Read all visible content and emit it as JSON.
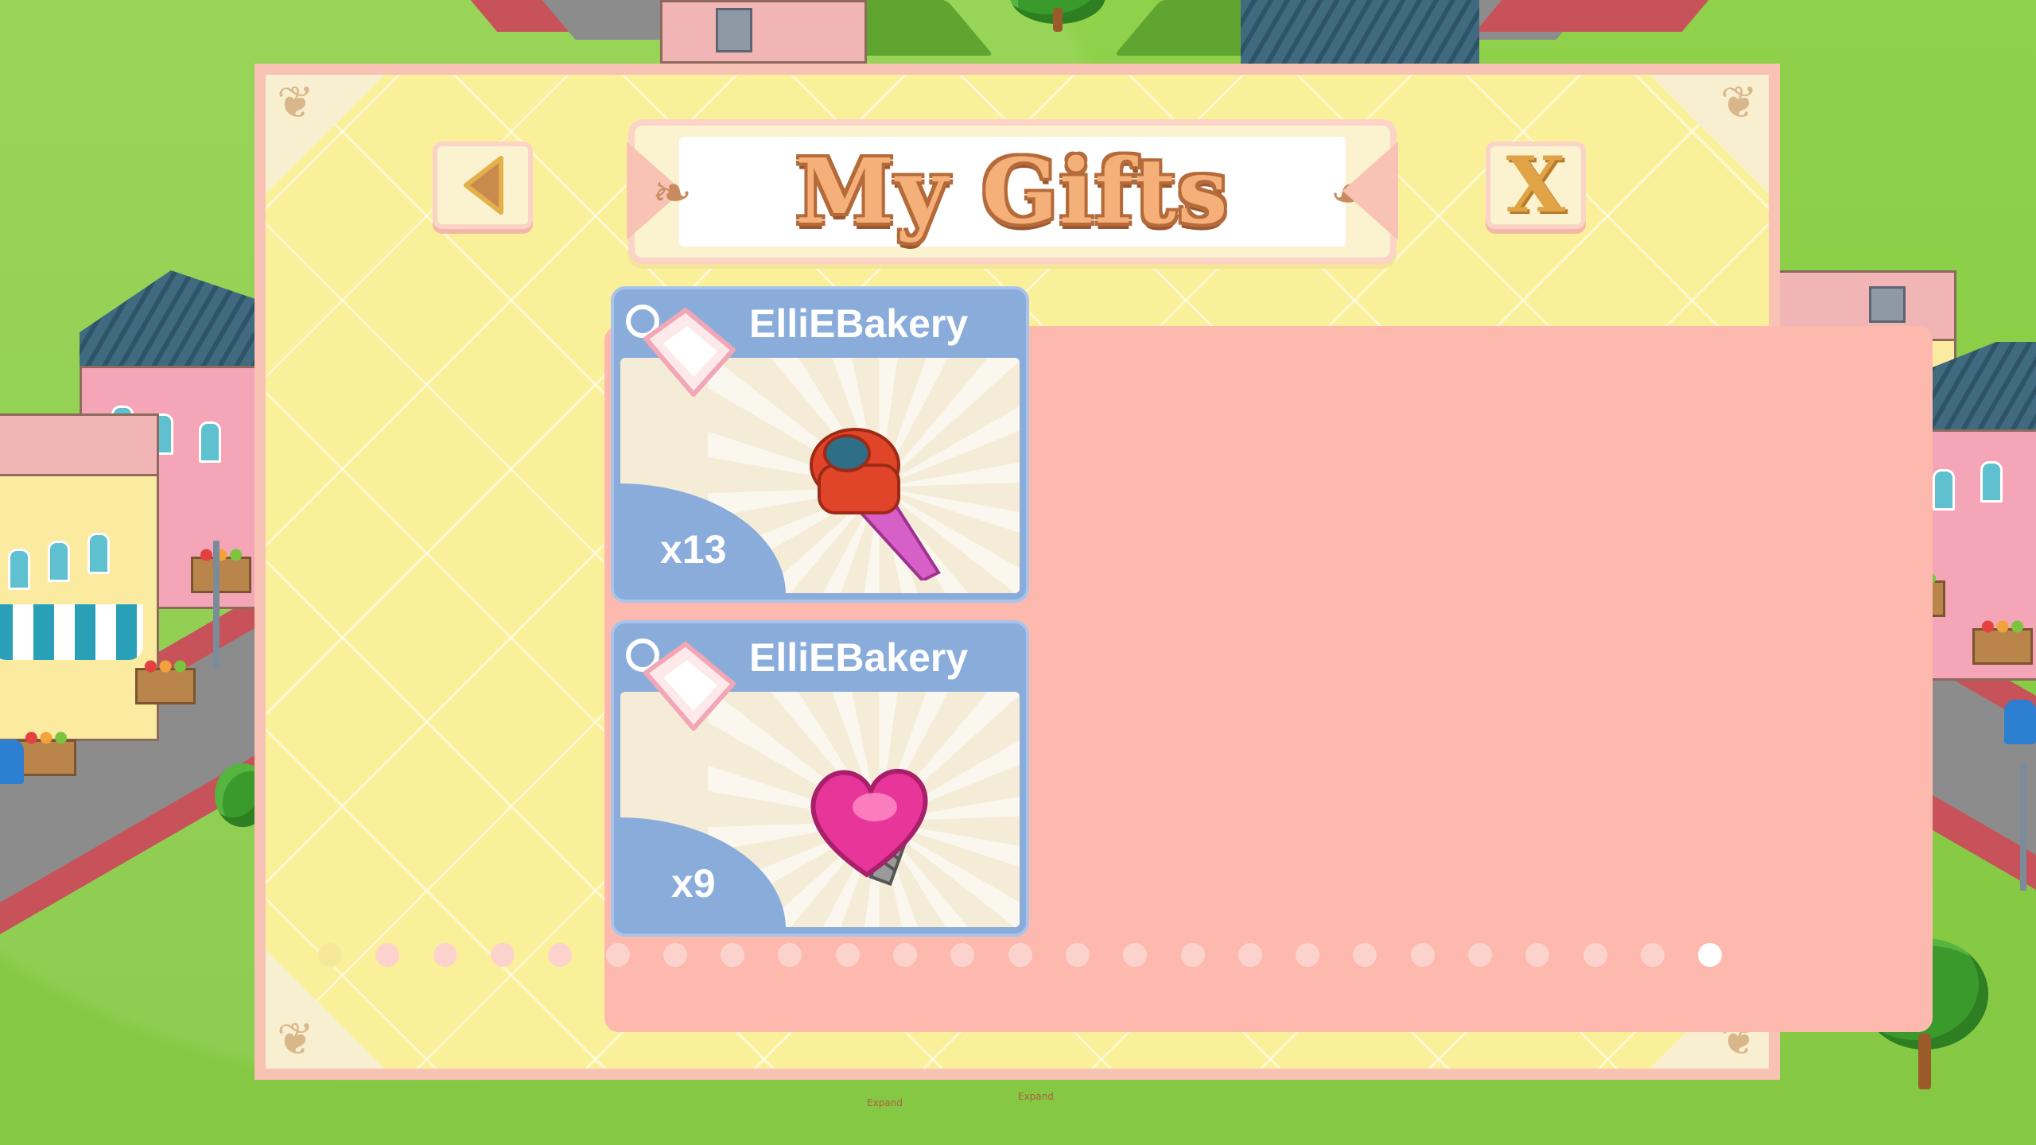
{
  "dialog": {
    "title": "My Gifts",
    "back_button_icon": "left-arrow-icon",
    "close_button_label": "X"
  },
  "gifts": [
    {
      "sender": "ElliEBakery",
      "quantity": "x13",
      "item_icon": "piping-tip-icon"
    },
    {
      "sender": "ElliEBakery",
      "quantity": "x9",
      "item_icon": "heart-piping-tip-icon"
    }
  ],
  "pagination": {
    "dot_count": 24,
    "active_index": 23
  },
  "background": {
    "expand_labels": [
      "Expand",
      "Expand"
    ]
  },
  "colors": {
    "grass": "#8fd14a",
    "dialog_border": "#f8c2b4",
    "dialog_fill": "#fbf09a",
    "panel": "#feb9ae",
    "card": "#89acdb",
    "title_text": "#f5b07a"
  }
}
